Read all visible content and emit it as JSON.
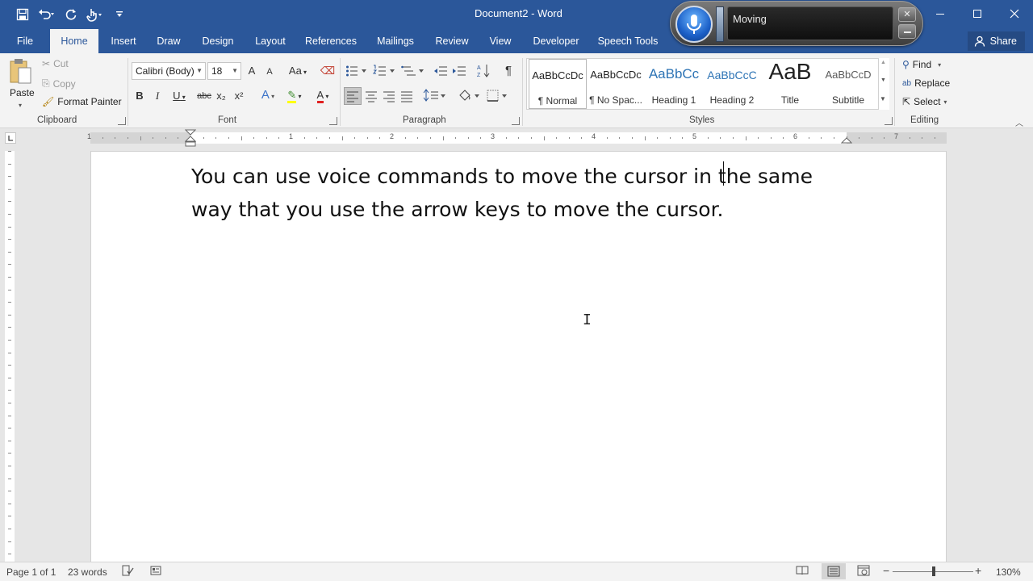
{
  "window": {
    "title": "Document2 - Word"
  },
  "tabs": [
    {
      "label": "File"
    },
    {
      "label": "Home"
    },
    {
      "label": "Insert"
    },
    {
      "label": "Draw"
    },
    {
      "label": "Design"
    },
    {
      "label": "Layout"
    },
    {
      "label": "References"
    },
    {
      "label": "Mailings"
    },
    {
      "label": "Review"
    },
    {
      "label": "View"
    },
    {
      "label": "Developer"
    },
    {
      "label": "Speech Tools"
    }
  ],
  "active_tab": "Home",
  "share": {
    "label": "Share"
  },
  "clipboard": {
    "paste": "Paste",
    "cut": "Cut",
    "copy": "Copy",
    "format_painter": "Format Painter",
    "group": "Clipboard"
  },
  "font": {
    "name": "Calibri (Body)",
    "size": "18",
    "group": "Font",
    "bold": "B",
    "italic": "I",
    "underline": "U",
    "strike": "abc",
    "sub": "x₂",
    "sup": "x²",
    "grow": "A",
    "shrink": "A",
    "case": "Aa"
  },
  "paragraph": {
    "group": "Paragraph"
  },
  "styles": {
    "group": "Styles",
    "items": [
      {
        "preview": "AaBbCcDc",
        "name": "¶ Normal"
      },
      {
        "preview": "AaBbCcDc",
        "name": "¶ No Spac..."
      },
      {
        "preview": "AaBbCc",
        "name": "Heading 1"
      },
      {
        "preview": "AaBbCcC",
        "name": "Heading 2"
      },
      {
        "preview": "AaB",
        "name": "Title"
      },
      {
        "preview": "AaBbCcD",
        "name": "Subtitle"
      }
    ]
  },
  "editing": {
    "group": "Editing",
    "find": "Find",
    "replace": "Replace",
    "select": "Select"
  },
  "speech": {
    "status": "Moving"
  },
  "ruler": {
    "numbers": [
      "1",
      "1",
      "2",
      "3",
      "4",
      "5",
      "6",
      "7"
    ]
  },
  "document": {
    "line1": "You can use voice commands to move the cursor in the same",
    "line2": "way that you use the arrow keys to move the cursor."
  },
  "status": {
    "page": "Page 1 of 1",
    "words": "23 words",
    "zoom": "130%"
  },
  "colors": {
    "accent": "#2b579a",
    "highlight": "#ffff00",
    "font_color": "#e02020"
  }
}
